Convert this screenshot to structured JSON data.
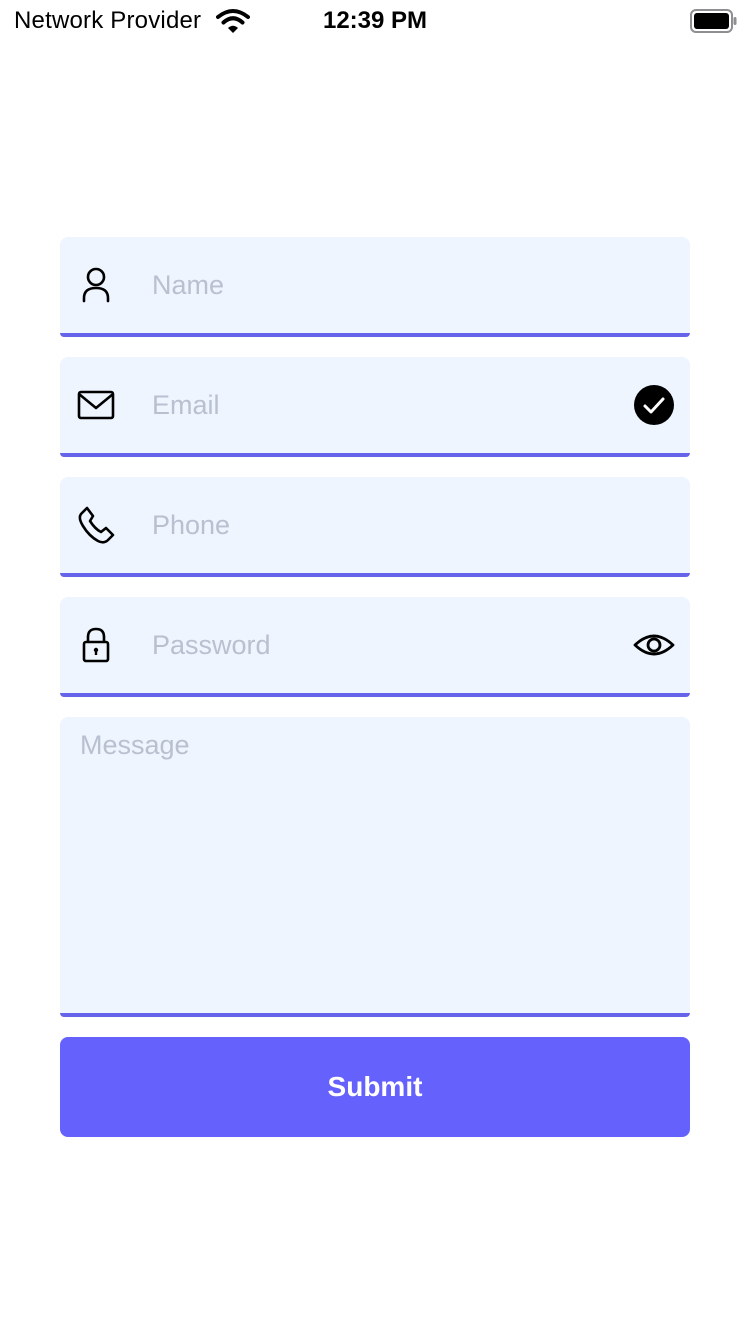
{
  "status_bar": {
    "carrier": "Network Provider",
    "time": "12:39 PM",
    "icons": [
      "wifi-icon",
      "battery-icon"
    ]
  },
  "form": {
    "fields": [
      {
        "placeholder": "Name",
        "icon": "person-icon"
      },
      {
        "placeholder": "Email",
        "icon": "envelope-icon",
        "trailing_icon": "check-circle-icon"
      },
      {
        "placeholder": "Phone",
        "icon": "phone-icon"
      },
      {
        "placeholder": "Password",
        "icon": "lock-icon",
        "trailing_icon": "eye-icon"
      },
      {
        "placeholder": "Message"
      }
    ],
    "submit_label": "Submit"
  },
  "colors": {
    "field_background": "#eef5ff",
    "field_underline": "#6563ea",
    "placeholder_text": "#b9c0cf",
    "submit_background": "#6561fc",
    "submit_text": "#ffffff"
  }
}
